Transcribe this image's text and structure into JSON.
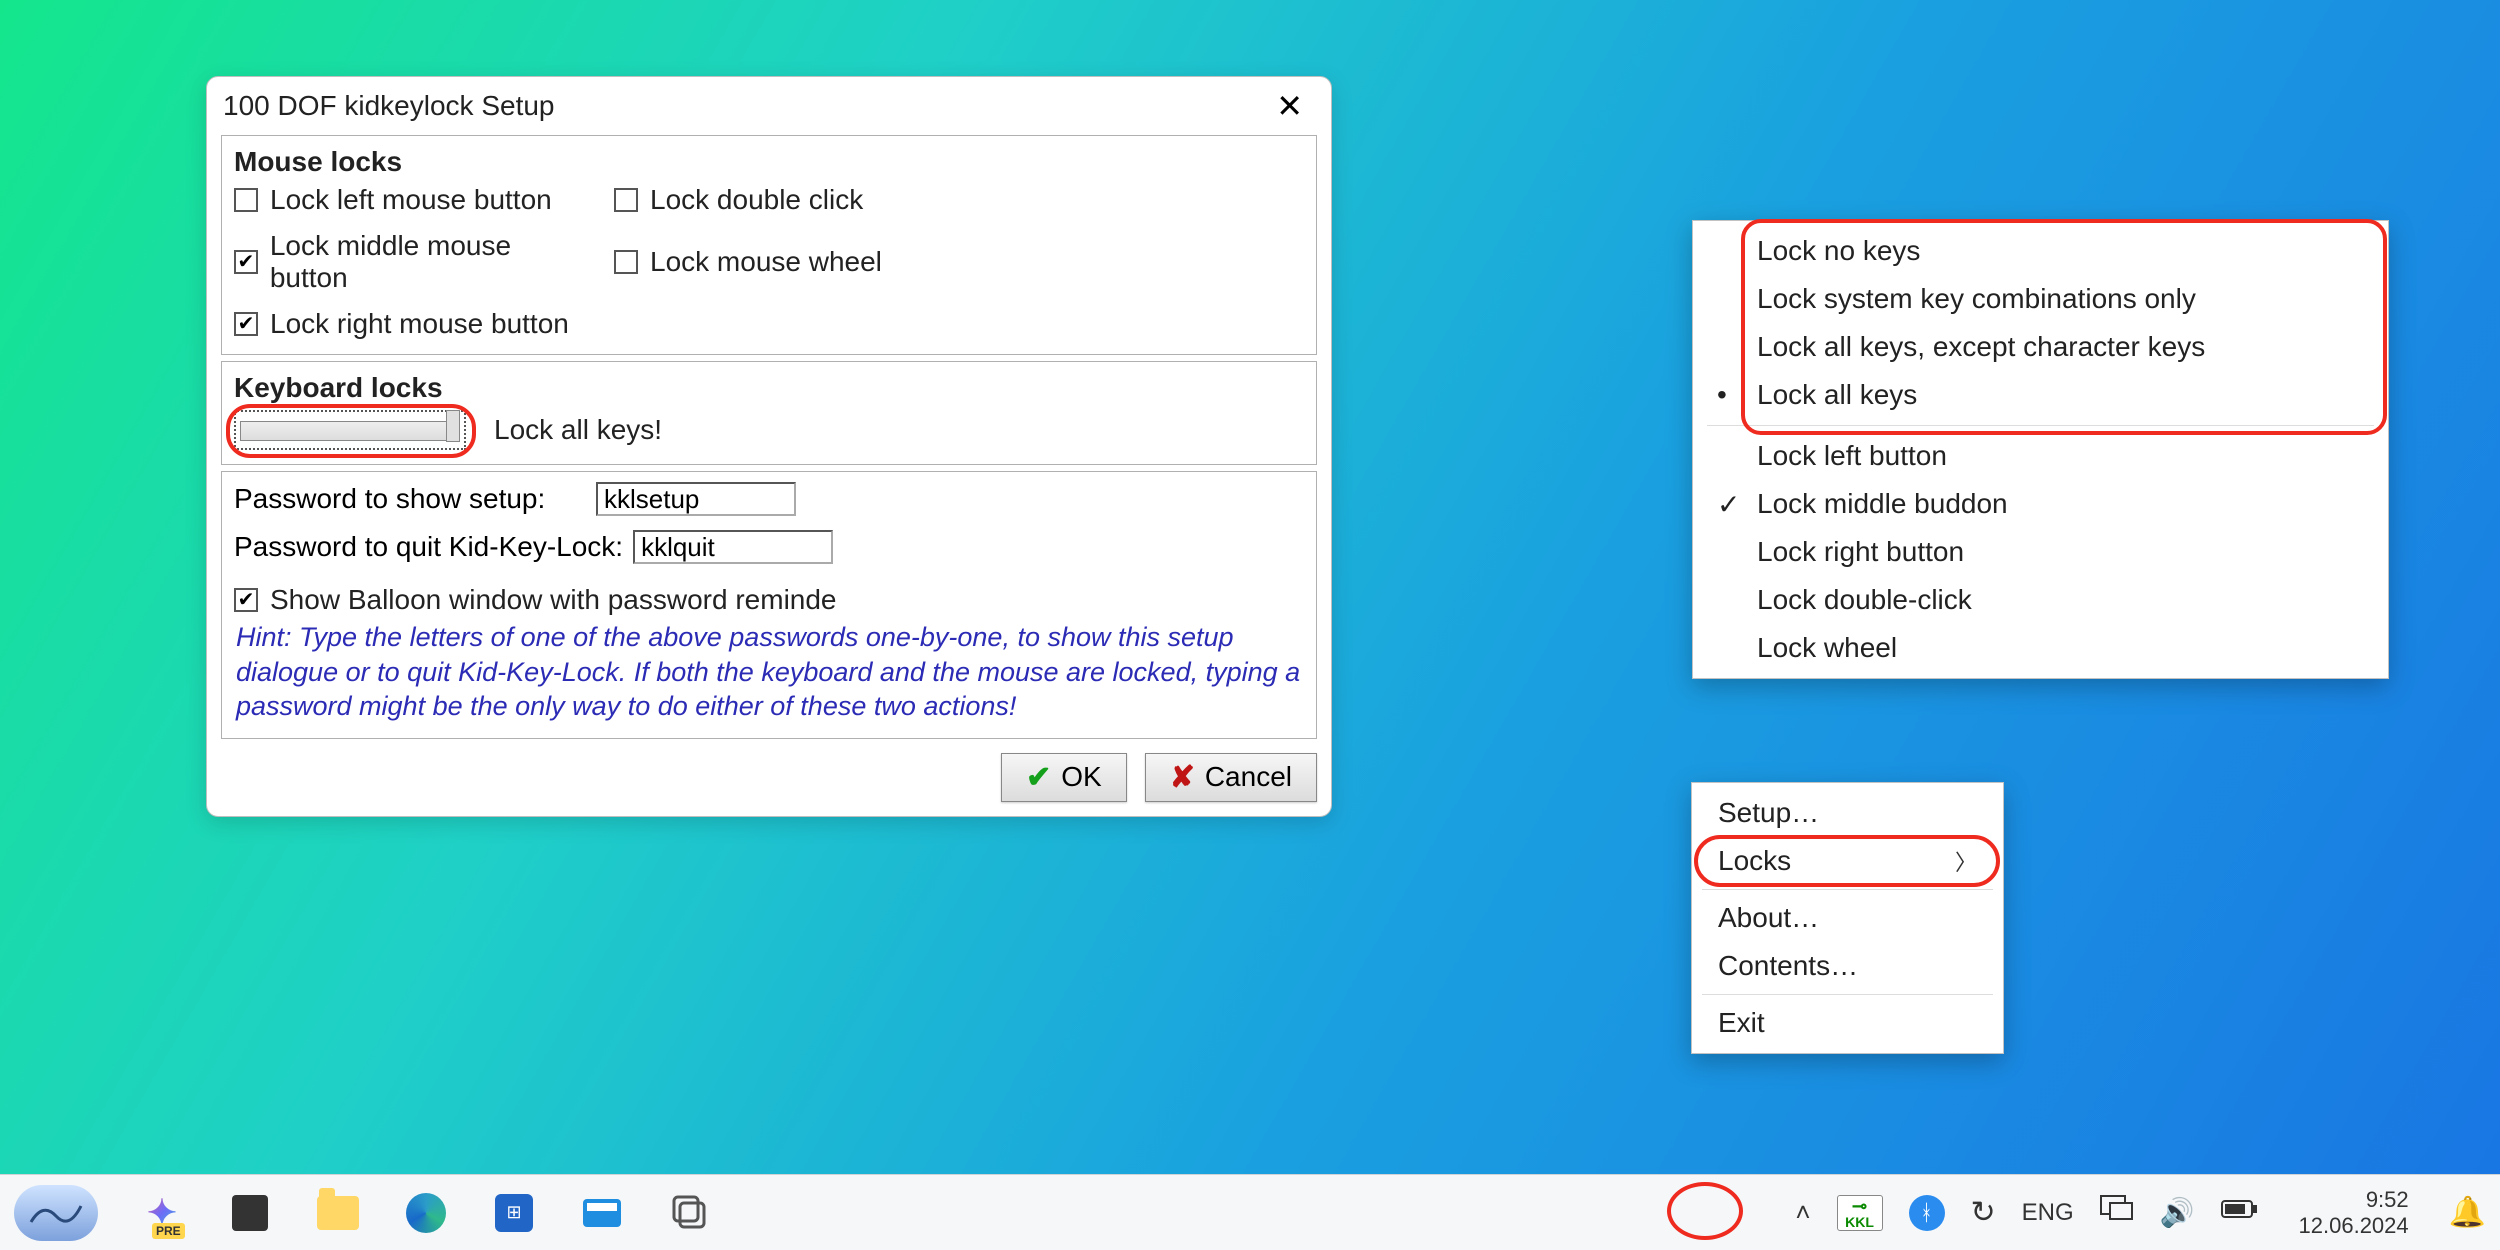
{
  "dialog": {
    "title": "100 DOF kidkeylock Setup",
    "mouse_panel": {
      "title": "Mouse locks",
      "items": [
        {
          "label": "Lock left mouse button",
          "checked": false
        },
        {
          "label": "Lock middle mouse button",
          "checked": true
        },
        {
          "label": "Lock right mouse button",
          "checked": true
        },
        {
          "label": "Lock double click",
          "checked": false
        },
        {
          "label": "Lock mouse wheel",
          "checked": false
        }
      ]
    },
    "keyboard_panel": {
      "title": "Keyboard locks",
      "slider_label": "Lock all keys!"
    },
    "passwords_panel": {
      "setup_label": "Password to show setup:",
      "setup_value": "kklsetup",
      "quit_label": "Password to quit Kid-Key-Lock:",
      "quit_value": "kklquit",
      "balloon_label": "Show Balloon window with password reminde",
      "balloon_checked": true,
      "hint": "Hint: Type the letters of one of the above passwords one-by-one, to show this setup dialogue or to quit Kid-Key-Lock. If both the keyboard and the mouse are locked, typing a password might be the only way to do either of these two actions!"
    },
    "buttons": {
      "ok": "OK",
      "cancel": "Cancel"
    }
  },
  "tray_menu": {
    "setup": "Setup…",
    "locks": "Locks",
    "about": "About…",
    "contents": "Contents…",
    "exit": "Exit"
  },
  "locks_menu": {
    "top": [
      {
        "label": "Lock no keys",
        "mark": ""
      },
      {
        "label": "Lock system key combinations only",
        "mark": ""
      },
      {
        "label": "Lock all keys, except character keys",
        "mark": ""
      },
      {
        "label": "Lock all keys",
        "mark": "•"
      }
    ],
    "bottom": [
      {
        "label": "Lock left button",
        "mark": ""
      },
      {
        "label": "Lock middle buddon",
        "mark": "✓"
      },
      {
        "label": "Lock right button",
        "mark": ""
      },
      {
        "label": "Lock double-click",
        "mark": ""
      },
      {
        "label": "Lock wheel",
        "mark": ""
      }
    ]
  },
  "taskbar": {
    "lang": "ENG",
    "time": "9:52",
    "date": "12.06.2024"
  }
}
